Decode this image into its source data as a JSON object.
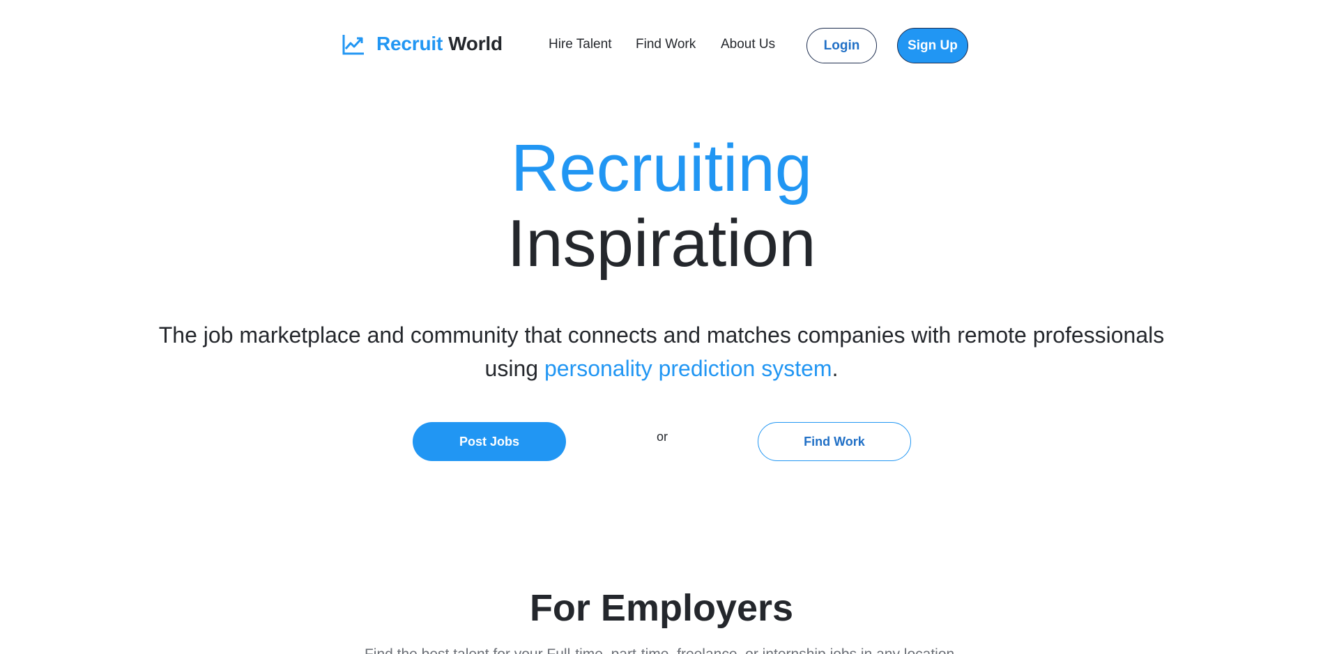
{
  "brand": {
    "icon": "trending-up-icon",
    "name_accent": "Recruit",
    "name_main": "World"
  },
  "nav": {
    "links": [
      "Hire Talent",
      "Find Work",
      "About Us"
    ],
    "login_label": "Login",
    "signup_label": "Sign Up"
  },
  "hero": {
    "title_line1": "Recruiting",
    "title_line2": "Inspiration",
    "subtitle_pre": "The job marketplace and community that connects and matches companies with remote professionals using ",
    "subtitle_accent": "personality prediction system",
    "subtitle_post": ".",
    "post_jobs_label": "Post Jobs",
    "or_label": "or",
    "find_work_label": "Find Work"
  },
  "employers": {
    "title": "For Employers",
    "subtitle": "Find the best talent for your Full-time, part-time, freelance, or internship jobs in any location."
  },
  "colors": {
    "accent": "#2196f3",
    "text": "#24272c",
    "border_dark": "#1b2b4d"
  }
}
